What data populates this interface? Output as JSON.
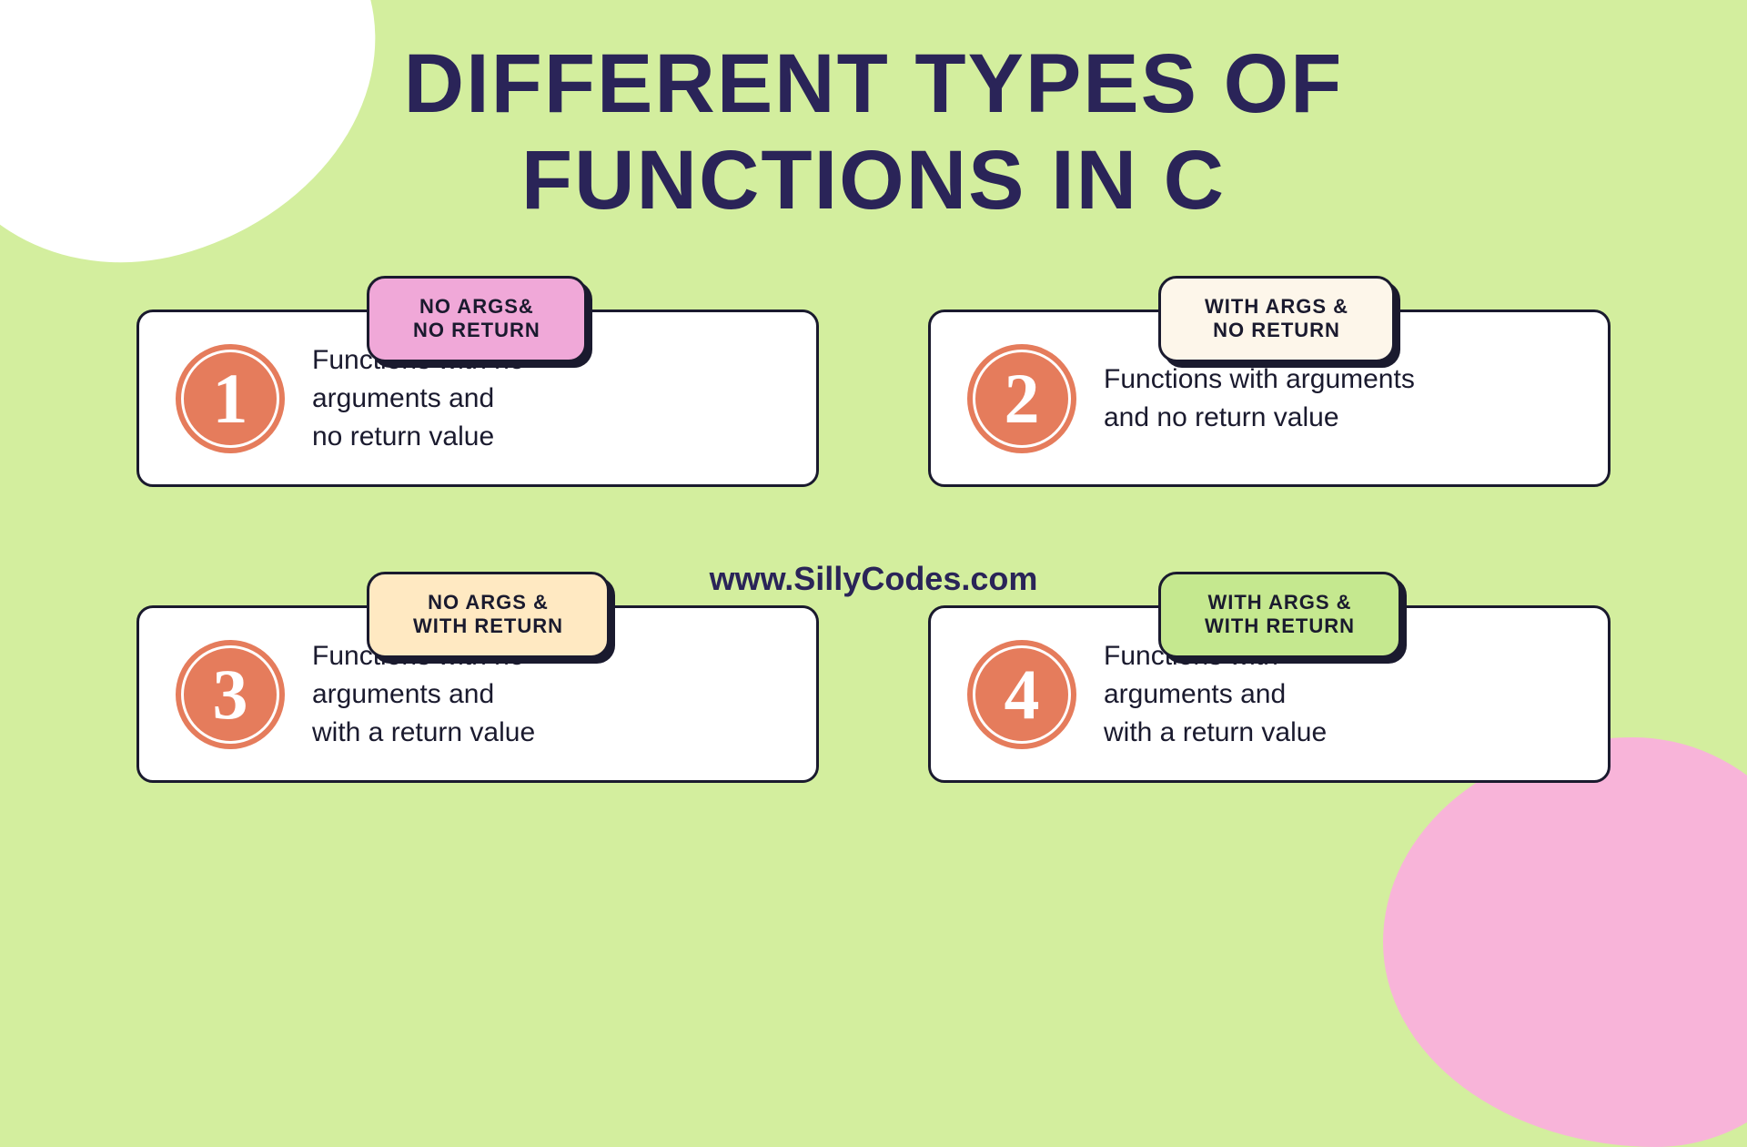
{
  "title": "DIFFERENT TYPES OF\nFUNCTIONS IN C",
  "website": "www.SillyCodes.com",
  "cards": [
    {
      "number": "1",
      "pill_label": "NO ARGS&\nNO RETURN",
      "pill_color": "pink",
      "description": "Functions with no\narguments and\nno return value"
    },
    {
      "number": "2",
      "pill_label": "WITH ARGS &\nNO RETURN",
      "pill_color": "cream",
      "description": "Functions with arguments\nand no return value"
    },
    {
      "number": "3",
      "pill_label": "NO ARGS &\nWITH RETURN",
      "pill_color": "yellow",
      "description": "Functions with no\narguments and\nwith a return value"
    },
    {
      "number": "4",
      "pill_label": "WITH ARGS &\nWITH RETURN",
      "pill_color": "green",
      "description": "Functions with\narguments and\nwith a return value"
    }
  ]
}
